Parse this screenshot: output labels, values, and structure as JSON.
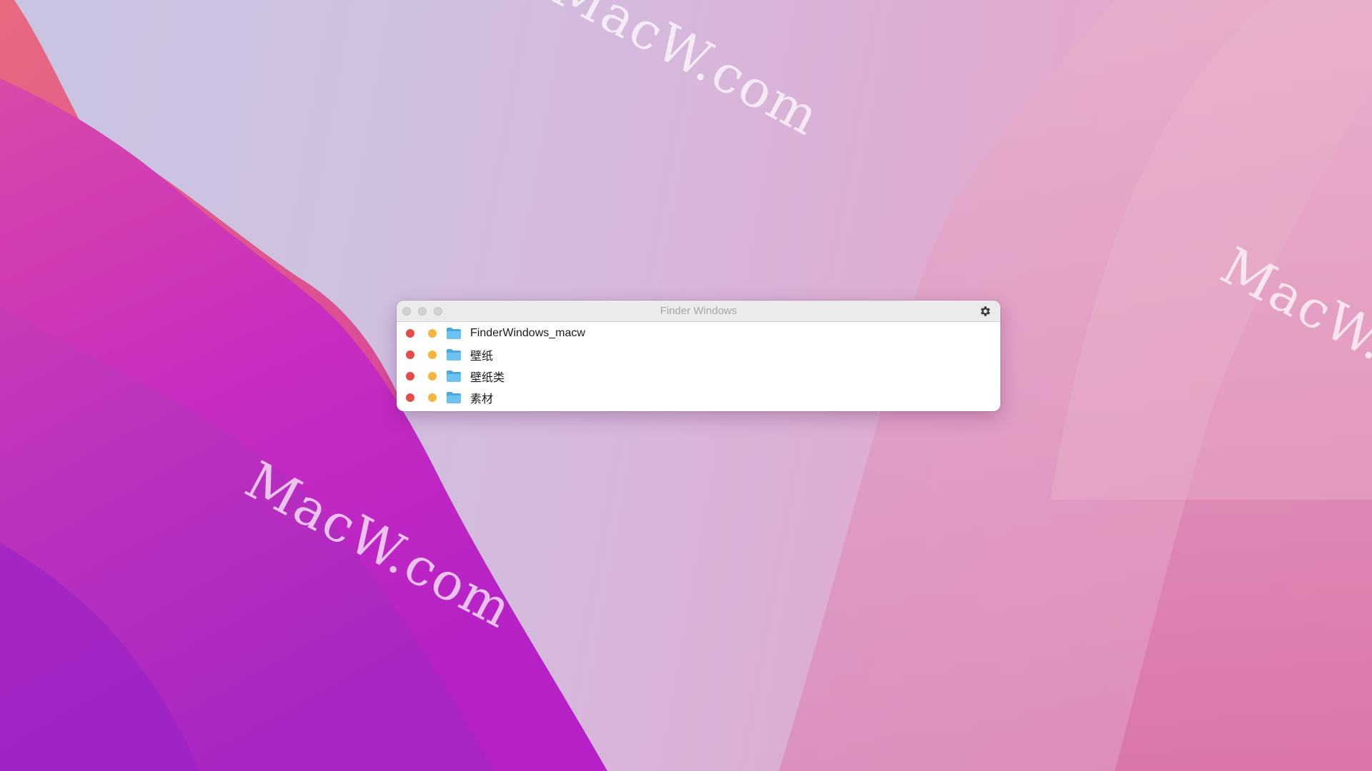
{
  "desktop": {
    "watermarks": [
      "MacW.com",
      "MacW.com",
      "MacW.com"
    ]
  },
  "window": {
    "title": "Finder Windows",
    "controls": [
      "close-icon",
      "minimize-icon",
      "zoom-icon"
    ],
    "settings_icon": "gear-icon",
    "rows": [
      {
        "name": "FinderWindows_macw",
        "icon": "folder-icon"
      },
      {
        "name": "壁纸",
        "icon": "folder-icon"
      },
      {
        "name": "壁纸类",
        "icon": "folder-icon"
      },
      {
        "name": "素材",
        "icon": "folder-icon"
      }
    ]
  },
  "colors": {
    "close_dot": "#e64a45",
    "minimize_dot": "#f4b63b",
    "folder": "#5fb8ec"
  }
}
